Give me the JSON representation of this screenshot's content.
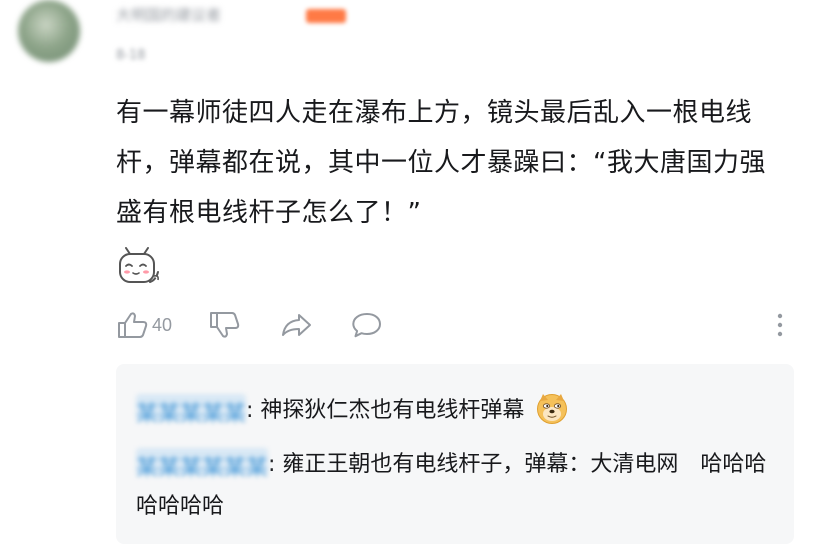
{
  "comment": {
    "username": "大明国的建议者",
    "time": "8-18",
    "text": "有一幕师徒四人走在瀑布上方，镜头最后乱入一根电线杆，弹幕都在说，其中一位人才暴躁曰：“我大唐国力强盛有根电线杆子怎么了！”",
    "emoji_icon": "shy-tv-emoji-icon",
    "like_count": "40"
  },
  "actions": {
    "like_icon": "thumb-up-icon",
    "dislike_icon": "thumb-down-icon",
    "share_icon": "share-arrow-icon",
    "reply_icon": "speech-bubble-icon",
    "more_icon": "more-vertical-icon"
  },
  "replies": [
    {
      "username": "某某某某某",
      "text": "神探狄仁杰也有电线杆弹幕",
      "emoji_icon": "doge-emoji-icon"
    },
    {
      "username": "某某某某某某",
      "text": "雍正王朝也有电线杆子，弹幕：大清电网　哈哈哈哈哈哈哈"
    }
  ],
  "colors": {
    "text": "#18191c",
    "muted": "#9499a0",
    "reply_bg": "#f6f7f8",
    "badge": "#ff7a45"
  }
}
